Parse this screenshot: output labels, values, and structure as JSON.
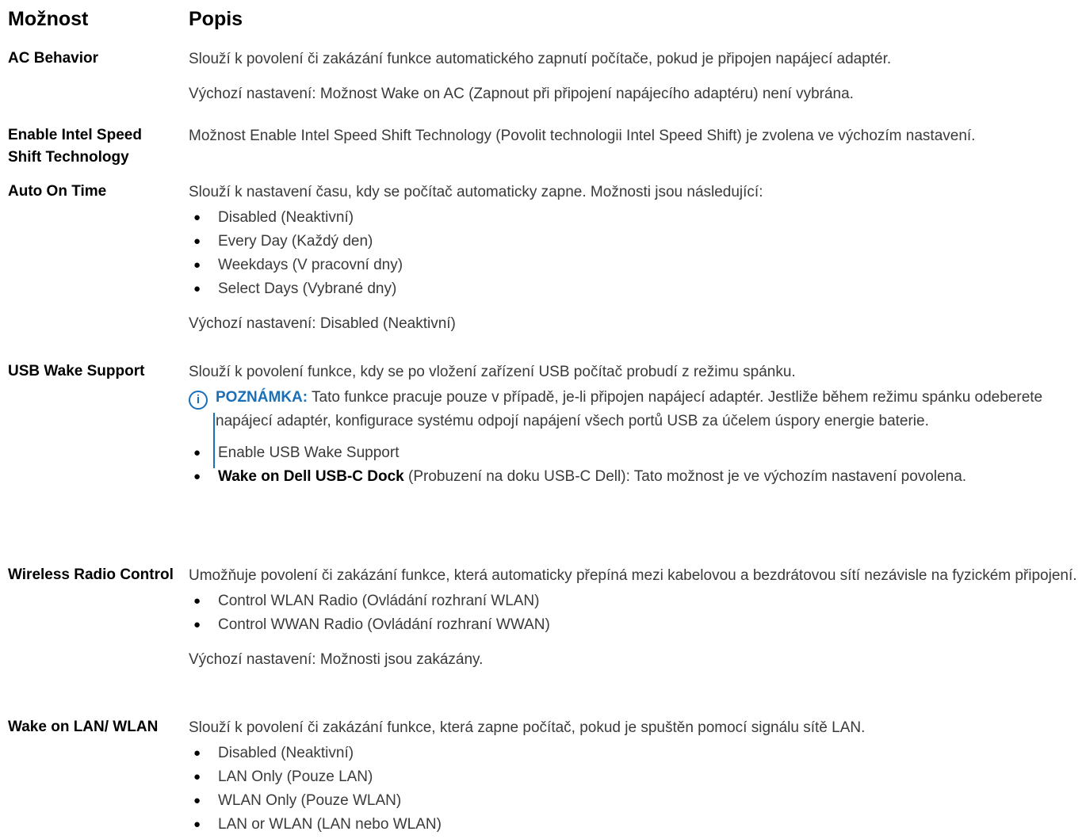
{
  "header": {
    "option": "Možnost",
    "description": "Popis"
  },
  "rows": [
    {
      "option": "AC Behavior",
      "paragraphs": [
        "Slouží k povolení či zakázání funkce automatického zapnutí počítače, pokud je připojen napájecí adaptér.",
        "Výchozí nastavení: Možnost Wake on AC (Zapnout při připojení napájecího adaptéru) není vybrána."
      ]
    },
    {
      "option": "Enable Intel Speed Shift Technology",
      "paragraphs": [
        "Možnost Enable Intel Speed Shift Technology (Povolit technologii Intel Speed Shift) je zvolena ve výchozím nastavení."
      ]
    },
    {
      "option": "Auto On Time",
      "intro": "Slouží k nastavení času, kdy se počítač automaticky zapne. Možnosti jsou následující:",
      "bullets": [
        "Disabled (Neaktivní)",
        "Every Day (Každý den)",
        "Weekdays (V pracovní dny)",
        "Select Days (Vybrané dny)"
      ],
      "default": "Výchozí nastavení: Disabled (Neaktivní)"
    },
    {
      "option": "USB Wake Support",
      "intro": "Slouží k povolení funkce, kdy se po vložení zařízení USB počítač probudí z režimu spánku.",
      "note_label": "POZNÁMKA:",
      "note_text": " Tato funkce pracuje pouze v případě, je-li připojen napájecí adaptér. Jestliže během režimu spánku odeberete napájecí adaptér, konfigurace systému odpojí napájení všech portů USB za účelem úspory energie baterie.",
      "bullet1": "Enable USB Wake Support",
      "bullet2_bold": "Wake on Dell USB-C Dock",
      "bullet2_rest": " (Probuzení na doku USB-C Dell): Tato možnost je ve výchozím nastavení povolena."
    },
    {
      "option": "Wireless Radio Control",
      "intro": "Umožňuje povolení či zakázání funkce, která automaticky přepíná mezi kabelovou a bezdrátovou sítí nezávisle na fyzickém připojení.",
      "bullets": [
        "Control WLAN Radio (Ovládání rozhraní WLAN)",
        "Control WWAN Radio (Ovládání rozhraní WWAN)"
      ],
      "default": "Výchozí nastavení: Možnosti jsou zakázány."
    },
    {
      "option": "Wake on LAN/ WLAN",
      "intro": "Slouží k povolení či zakázání funkce, která zapne počítač, pokud je spuštěn pomocí signálu sítě LAN.",
      "bullets": [
        "Disabled (Neaktivní)",
        "LAN Only (Pouze LAN)",
        "WLAN Only (Pouze WLAN)",
        "LAN or WLAN (LAN nebo WLAN)"
      ]
    }
  ]
}
